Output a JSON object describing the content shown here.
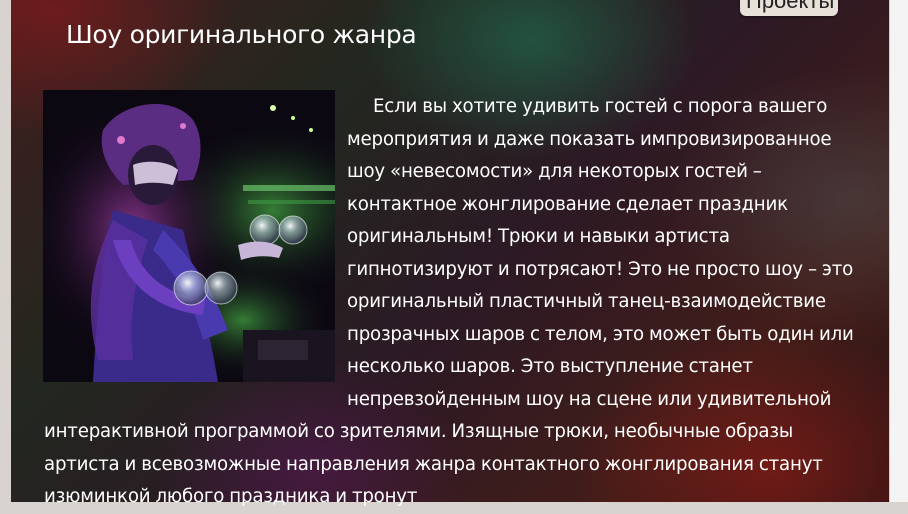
{
  "nav": {
    "projects_label": "Проекты"
  },
  "section": {
    "title": "Шоу оригинального жанра",
    "paragraph": "Если вы хотите удивить гостей с порога вашего мероприятия и даже показать импровизированное шоу «невесомости» для некоторых гостей – контактное жонглирование сделает праздник оригинальным! Трюки и навыки артиста гипнотизируют и потрясают! Это не просто шоу – это оригинальный пластичный танец-взаимодействие прозрачных шаров с телом, это может быть один или несколько шаров. Это выступление станет непревзойденным шоу на сцене или удивительной интерактивной программой со зрителями. Изящные трюки, необычные образы артиста и всевозможные направления жанра контактного жонглирования станут изюминкой любого праздника и тронут"
  },
  "colors": {
    "text": "#ffffff",
    "button_bg": "#e8e1d9"
  },
  "image": {
    "subject": "juggler-with-crystal-balls-photo"
  }
}
